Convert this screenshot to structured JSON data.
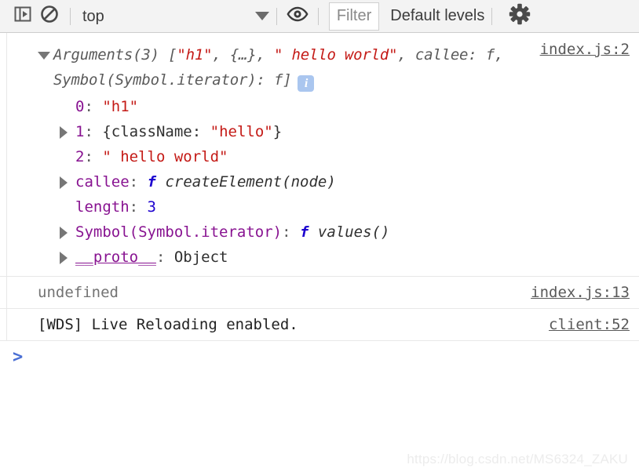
{
  "toolbar": {
    "sidebar_toggle_icon": "console-sidebar-icon",
    "clear_icon": "clear-console-icon",
    "context_label": "top",
    "context_arrow_icon": "chevron-down-icon",
    "eye_icon": "live-expression-eye-icon",
    "filter_placeholder": "Filter",
    "levels_label": "Default levels",
    "gear_icon": "settings-gear-icon"
  },
  "console": {
    "object_message": {
      "source_link": "index.js:2",
      "headline": {
        "prefix": "Arguments(3) [",
        "str0": "\"h1\"",
        "sep0": ", ",
        "obj1": "{…}",
        "sep1": ", ",
        "str2": "\" hello world\"",
        "sep2": ", ",
        "callee_key": "callee:",
        "callee_val": " f, ",
        "symbol_tail": "Symbol(Symbol.iterator): f]"
      },
      "info_badge": "i",
      "properties": [
        {
          "expandable": false,
          "key": "0",
          "colon": ": ",
          "value": "\"h1\"",
          "value_type": "string"
        },
        {
          "expandable": true,
          "key": "1",
          "colon": ": ",
          "value_prefix": "{className: ",
          "value": "\"hello\"",
          "value_suffix": "}",
          "value_type": "object"
        },
        {
          "expandable": false,
          "key": "2",
          "colon": ": ",
          "value": "\" hello world\"",
          "value_type": "string"
        },
        {
          "expandable": true,
          "key": "callee",
          "colon": ": ",
          "fn_glyph": "f",
          "value": "createElement(node)",
          "value_type": "function"
        },
        {
          "expandable": false,
          "key": "length",
          "colon": ": ",
          "value": "3",
          "value_type": "number"
        },
        {
          "expandable": true,
          "key": "Symbol(Symbol.iterator)",
          "colon": ": ",
          "fn_glyph": "f",
          "value": "values()",
          "value_type": "function"
        },
        {
          "expandable": true,
          "key": "__proto__",
          "colon": ": ",
          "value": "Object",
          "value_type": "plain"
        }
      ]
    },
    "messages": [
      {
        "text": "undefined",
        "source_link": "index.js:13",
        "style": "undefined"
      },
      {
        "text": "[WDS] Live Reloading enabled.",
        "source_link": "client:52",
        "style": "log"
      }
    ],
    "prompt_chevron": ">"
  },
  "watermark": "https://blog.csdn.net/MS6324_ZAKU"
}
